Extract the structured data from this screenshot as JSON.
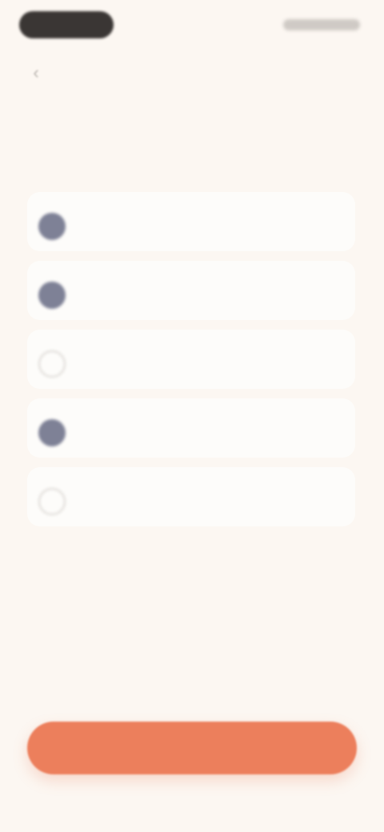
{
  "status_bar": {
    "time": "",
    "indicators": ""
  },
  "nav": {
    "back_icon": "chevron-left-icon",
    "back_glyph": "‹"
  },
  "header": {
    "title": "",
    "subtitle": ""
  },
  "options": [
    {
      "label": "",
      "checked": true
    },
    {
      "label": "",
      "checked": true
    },
    {
      "label": "",
      "checked": false
    },
    {
      "label": "",
      "checked": true
    },
    {
      "label": "",
      "checked": false
    }
  ],
  "cta": {
    "label": ""
  },
  "colors": {
    "background": "#fcf7f2",
    "accent": "#ec7f5c",
    "checked": "#7e8196",
    "card": "#fdfcfa"
  }
}
